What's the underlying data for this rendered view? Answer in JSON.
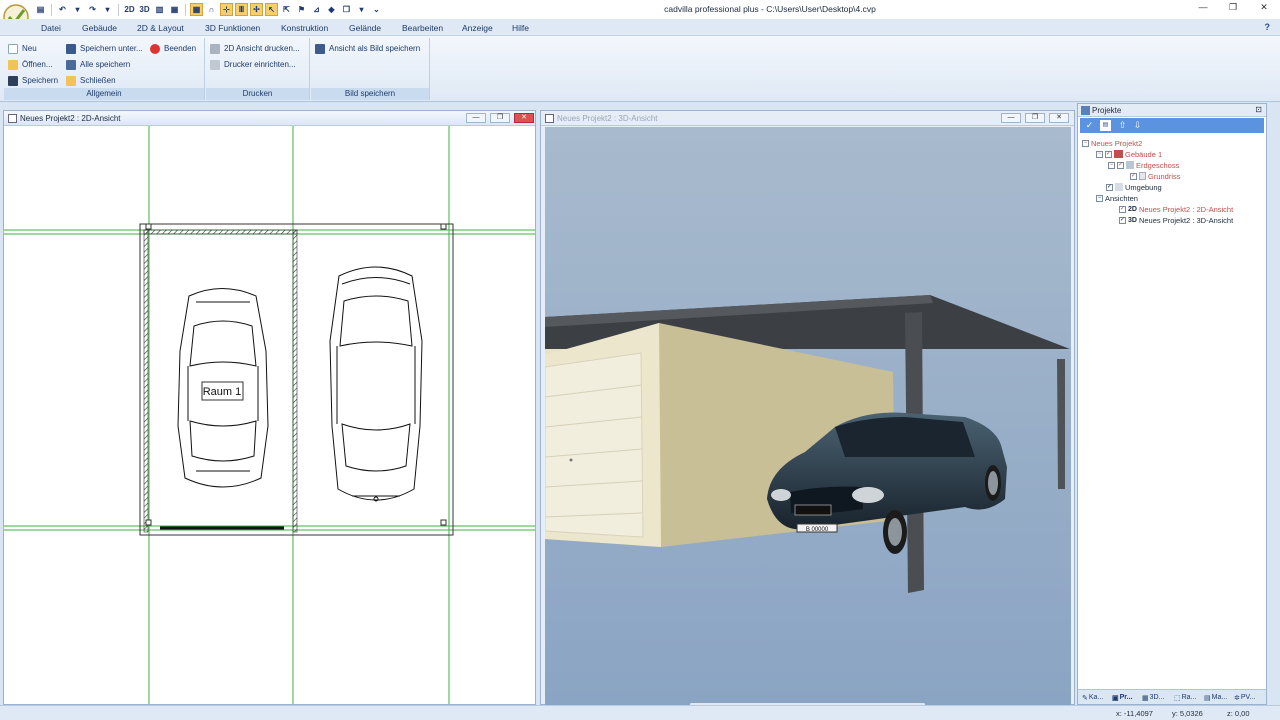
{
  "window": {
    "title": "cadvilla professional plus - C:\\Users\\User\\Desktop\\4.cvp"
  },
  "quick_access": [
    "2D",
    "3D"
  ],
  "menu": [
    "Datei",
    "Gebäude",
    "2D & Layout",
    "3D Funktionen",
    "Konstruktion",
    "Gelände",
    "Bearbeiten",
    "Anzeige",
    "Hilfe"
  ],
  "ribbon": {
    "allgemein": {
      "label": "Allgemein",
      "neu": "Neu",
      "oeffnen": "Öffnen...",
      "speichern": "Speichern",
      "speichern_unter": "Speichern unter...",
      "alle_speichern": "Alle speichern",
      "schliessen": "Schließen",
      "beenden": "Beenden"
    },
    "drucken": {
      "label": "Drucken",
      "ansicht_drucken": "2D Ansicht drucken...",
      "drucker_einrichten": "Drucker einrichten..."
    },
    "bild": {
      "label": "Bild speichern",
      "ansicht_speichern": "Ansicht als Bild speichern"
    }
  },
  "panel2d": {
    "title": "Neues Projekt2 : 2D-Ansicht",
    "room_label": "Raum 1"
  },
  "panel3d": {
    "title": "Neues Projekt2 : 3D-Ansicht",
    "plate": "B 00000"
  },
  "projects": {
    "title": "Projekte",
    "tree": {
      "root": "Neues Projekt2",
      "building": "Gebäude 1",
      "floor": "Erdgeschoss",
      "plan": "Grundriss",
      "environment": "Umgebung",
      "views": "Ansichten",
      "view2d_tag": "2D",
      "view2d": "Neues Projekt2 : 2D-Ansicht",
      "view3d_tag": "3D",
      "view3d": "Neues Projekt2 : 3D-Ansicht"
    },
    "tabs": [
      "Ka...",
      "Pr...",
      "3D...",
      "Ra...",
      "Ma...",
      "PV..."
    ]
  },
  "status": {
    "x": "x: -11,4097",
    "y": "y: 5,0326",
    "z": "z: 0,00"
  },
  "colors": {
    "accent": "#5b93e0",
    "tree_red": "#c0504d",
    "sky": "#9fb4cc",
    "grid_green": "#3cb043"
  }
}
